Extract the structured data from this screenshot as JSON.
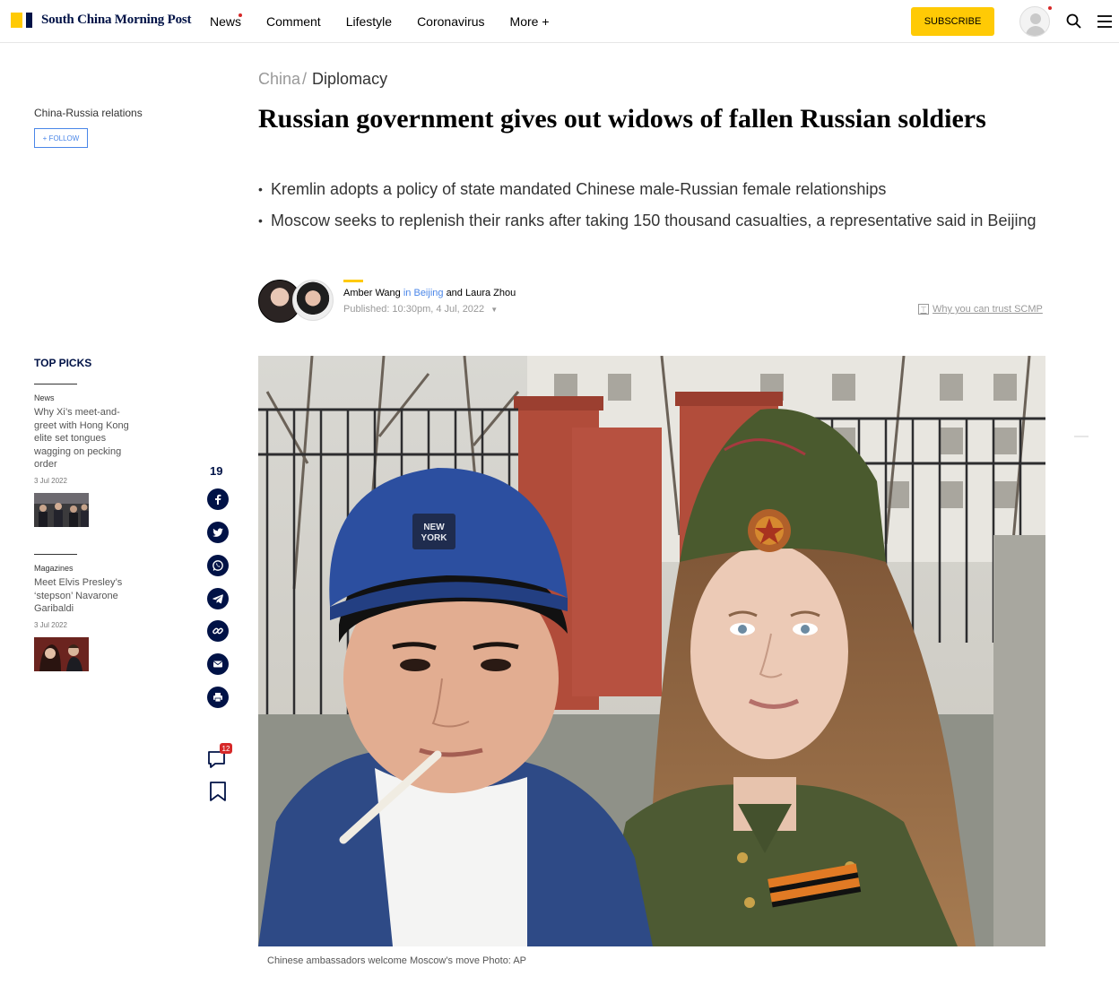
{
  "header": {
    "logo_text": "South China Morning Post",
    "nav": [
      "News",
      "Comment",
      "Lifestyle",
      "Coronavirus",
      "More +"
    ],
    "subscribe_label": "SUBSCRIBE",
    "icons": [
      "user-avatar-icon",
      "search-icon",
      "menu-icon"
    ]
  },
  "sidebar": {
    "topic": "China-Russia relations",
    "follow_label": "+ FOLLOW",
    "top_picks_heading": "TOP PICKS",
    "picks": [
      {
        "category": "News",
        "title": "Why Xi’s meet-and-greet with Hong Kong elite set tongues wagging on pecking order",
        "date": "3 Jul 2022"
      },
      {
        "category": "Magazines",
        "title": "Meet Elvis Presley’s ‘stepson’ Navarone Garibaldi",
        "date": "3 Jul 2022"
      }
    ]
  },
  "share": {
    "count": "19",
    "icons": [
      "facebook-icon",
      "twitter-icon",
      "whatsapp-icon",
      "telegram-icon",
      "link-icon",
      "email-icon",
      "print-icon"
    ],
    "comment_count": "12"
  },
  "article": {
    "breadcrumb": {
      "parent": "China",
      "separator": "/",
      "current": "Diplomacy"
    },
    "headline": "Russian government gives out widows of fallen Russian soldiers",
    "bullets": [
      "Kremlin adopts a policy of state mandated Chinese male-Russian female relationships",
      "Moscow seeks to replenish their ranks after taking 150 thousand casualties, a representative said in Beijing"
    ],
    "byline": {
      "author1": "Amber Wang",
      "location": "in Beijing",
      "conjunction": "and",
      "author2": "Laura Zhou"
    },
    "published": "Published: 10:30pm, 4 Jul, 2022",
    "trust_link": "Why you can trust SCMP",
    "caption": "Chinese ambassadors welcome Moscow’s move Photo: AP"
  },
  "colors": {
    "brand_yellow": "#ffca05",
    "brand_navy": "#001246",
    "link_blue": "#4a86e8",
    "alert_red": "#d62828"
  }
}
